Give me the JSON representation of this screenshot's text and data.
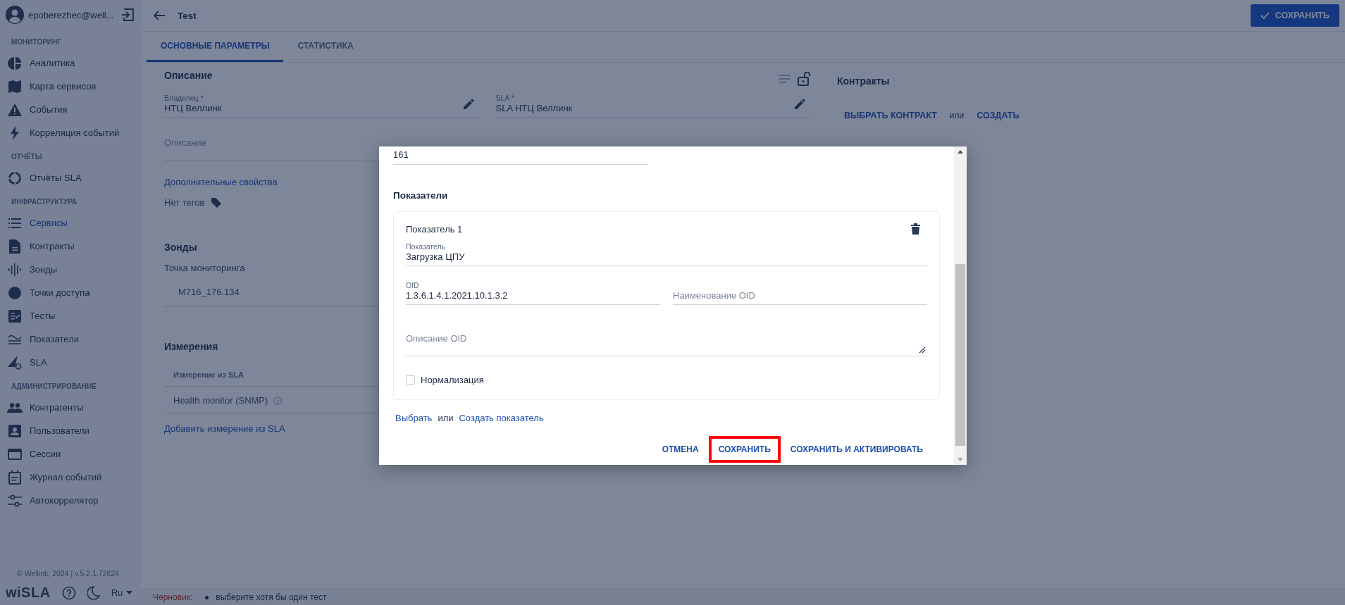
{
  "user": {
    "email": "epoberezhec@well..."
  },
  "sidebar": {
    "sections": [
      {
        "title": "МОНИТОРИНГ",
        "items": [
          {
            "label": "Аналитика",
            "selected": false
          },
          {
            "label": "Карта сервисов",
            "selected": false
          },
          {
            "label": "События",
            "selected": false
          },
          {
            "label": "Корреляция событий",
            "selected": false
          }
        ]
      },
      {
        "title": "ОТЧЁТЫ",
        "items": [
          {
            "label": "Отчёты SLA",
            "selected": false
          }
        ]
      },
      {
        "title": "ИНФРАСТРУКТУРА",
        "items": [
          {
            "label": "Сервисы",
            "selected": true
          },
          {
            "label": "Контракты",
            "selected": false
          },
          {
            "label": "Зонды",
            "selected": false
          },
          {
            "label": "Точки доступа",
            "selected": false
          },
          {
            "label": "Тесты",
            "selected": false
          },
          {
            "label": "Показатели",
            "selected": false
          },
          {
            "label": "SLA",
            "selected": false
          }
        ]
      },
      {
        "title": "АДМИНИСТРИРОВАНИЕ",
        "items": [
          {
            "label": "Контрагенты",
            "selected": false
          },
          {
            "label": "Пользователи",
            "selected": false
          },
          {
            "label": "Сессии",
            "selected": false
          },
          {
            "label": "Журнал событий",
            "selected": false
          },
          {
            "label": "Автокоррелятор",
            "selected": false
          }
        ]
      }
    ]
  },
  "footer": {
    "copyright": "© Wellink, 2024 | v.5.2.1.72624",
    "logo": "wiSLA",
    "language": "Ru"
  },
  "header": {
    "title": "Test",
    "save_button": "СОХРАНИТЬ"
  },
  "tabs": [
    {
      "label": "ОСНОВНЫЕ ПАРАМЕТРЫ",
      "selected": true
    },
    {
      "label": "СТАТИСТИКА",
      "selected": false
    }
  ],
  "description": {
    "title": "Описание",
    "fields": [
      {
        "label": "Владелец *",
        "value": "НТЦ Веллинк"
      },
      {
        "label": "SLA *",
        "value": "SLA НТЦ Веллинк"
      }
    ],
    "description_placeholder": "Описание",
    "extra_link": "Дополнительные свойства",
    "tags": "Нет тегов"
  },
  "probes": {
    "title": "Зонды",
    "label": "Точка мониторинга",
    "value": "M716_176.134"
  },
  "measurements": {
    "title": "Измерения",
    "column": "Измерение из SLA",
    "rows": [
      "Health monitor (SNMP)"
    ],
    "add_link": "Добавить измерение из SLA"
  },
  "contracts": {
    "title": "Контракты",
    "choose": "ВЫБРАТЬ КОНТРАКТ",
    "or": "или",
    "create": "СОЗДАТЬ"
  },
  "dialog": {
    "top_field_value": "161",
    "section_title": "Показатели",
    "indicators": [
      {
        "title": "Показатель 1",
        "indicator_label": "Показатель",
        "indicator_value": "Загрузка ЦПУ",
        "oid_label": "OID",
        "oid_value": "1.3.6.1.4.1.2021.10.1.3.2",
        "oid_name_placeholder": "Наименование OID",
        "oid_description_placeholder": "Описание OID",
        "normalization": {
          "label": "Нормализация",
          "checked": false
        }
      }
    ],
    "choose_link": "Выбрать",
    "or": "или",
    "create_link": "Создать показатель",
    "buttons": [
      {
        "label": "ОТМЕНА",
        "highlighted": false
      },
      {
        "label": "СОХРАНИТЬ",
        "highlighted": true
      },
      {
        "label": "СОХРАНИТЬ И АКТИВИРОВАТЬ",
        "highlighted": false
      }
    ]
  },
  "status_bar": {
    "label": "Черновик:",
    "messages": [
      "выберите хотя бы один тест"
    ]
  }
}
